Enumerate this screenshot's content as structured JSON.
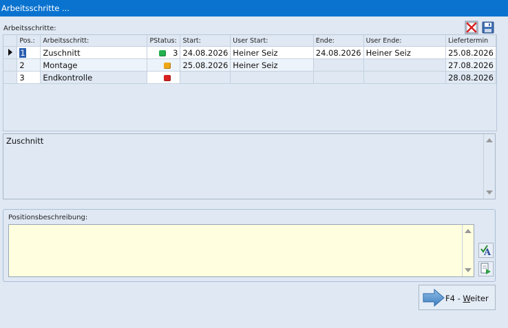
{
  "window": {
    "title": "Arbeitsschritte ..."
  },
  "section_label": "Arbeitsschritte:",
  "toolbar": {
    "delete_icon": "delete-x-icon",
    "save_icon": "floppy-disk-icon"
  },
  "grid": {
    "columns": [
      "Pos.:",
      "Arbeitsschritt:",
      "PStatus:",
      "Start:",
      "User Start:",
      "Ende:",
      "User Ende:",
      "Liefertermin"
    ],
    "rows": [
      {
        "pos": "1",
        "step": "Zuschnitt",
        "status_color": "#22b14c",
        "status_count": "3",
        "start": "24.08.2026",
        "user_start": "Heiner Seiz",
        "end": "24.08.2026",
        "user_end": "Heiner Seiz",
        "delivery": "25.08.2026"
      },
      {
        "pos": "2",
        "step": "Montage",
        "status_color": "#f0a818",
        "status_count": "",
        "start": "25.08.2026",
        "user_start": "Heiner Seiz",
        "end": "",
        "user_end": "",
        "delivery": "27.08.2026"
      },
      {
        "pos": "3",
        "step": "Endkontrolle",
        "status_color": "#d82020",
        "status_count": "",
        "start": "",
        "user_start": "",
        "end": "",
        "user_end": "",
        "delivery": "28.08.2026"
      }
    ]
  },
  "step_memo": {
    "text": "Zuschnitt"
  },
  "position_description": {
    "label": "Positionsbeschreibung:",
    "value": ""
  },
  "side_buttons": {
    "spellcheck_icon": "spellcheck-icon",
    "insert_icon": "insert-text-icon"
  },
  "weiter_button": {
    "key": "F4 - ",
    "mnemonic": "W",
    "rest": "eiter"
  }
}
